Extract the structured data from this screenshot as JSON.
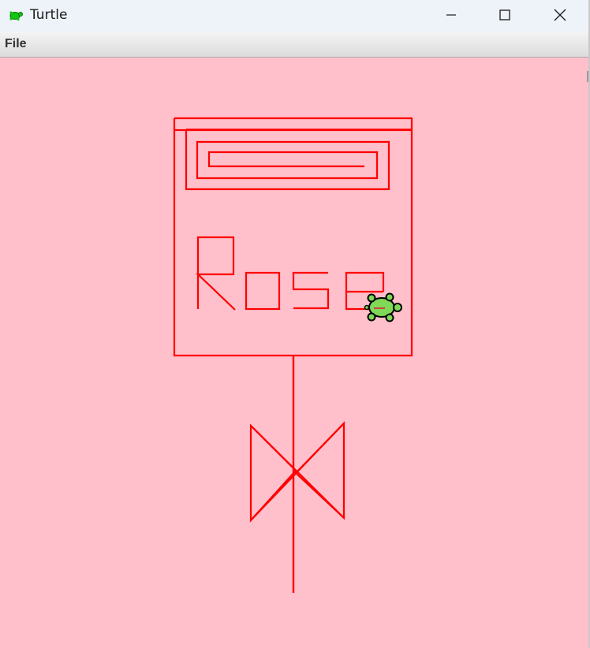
{
  "window": {
    "title": "Turtle",
    "icon": "turtle-icon",
    "controls": {
      "minimize": "minimize-icon",
      "maximize": "maximize-icon",
      "close": "close-icon"
    }
  },
  "menu": {
    "file_label": "File"
  },
  "canvas": {
    "background_color": "#ffc0cb",
    "pen_color": "#ff0000",
    "turtle_color": "#7ed957",
    "drawing_text": "Rose"
  }
}
